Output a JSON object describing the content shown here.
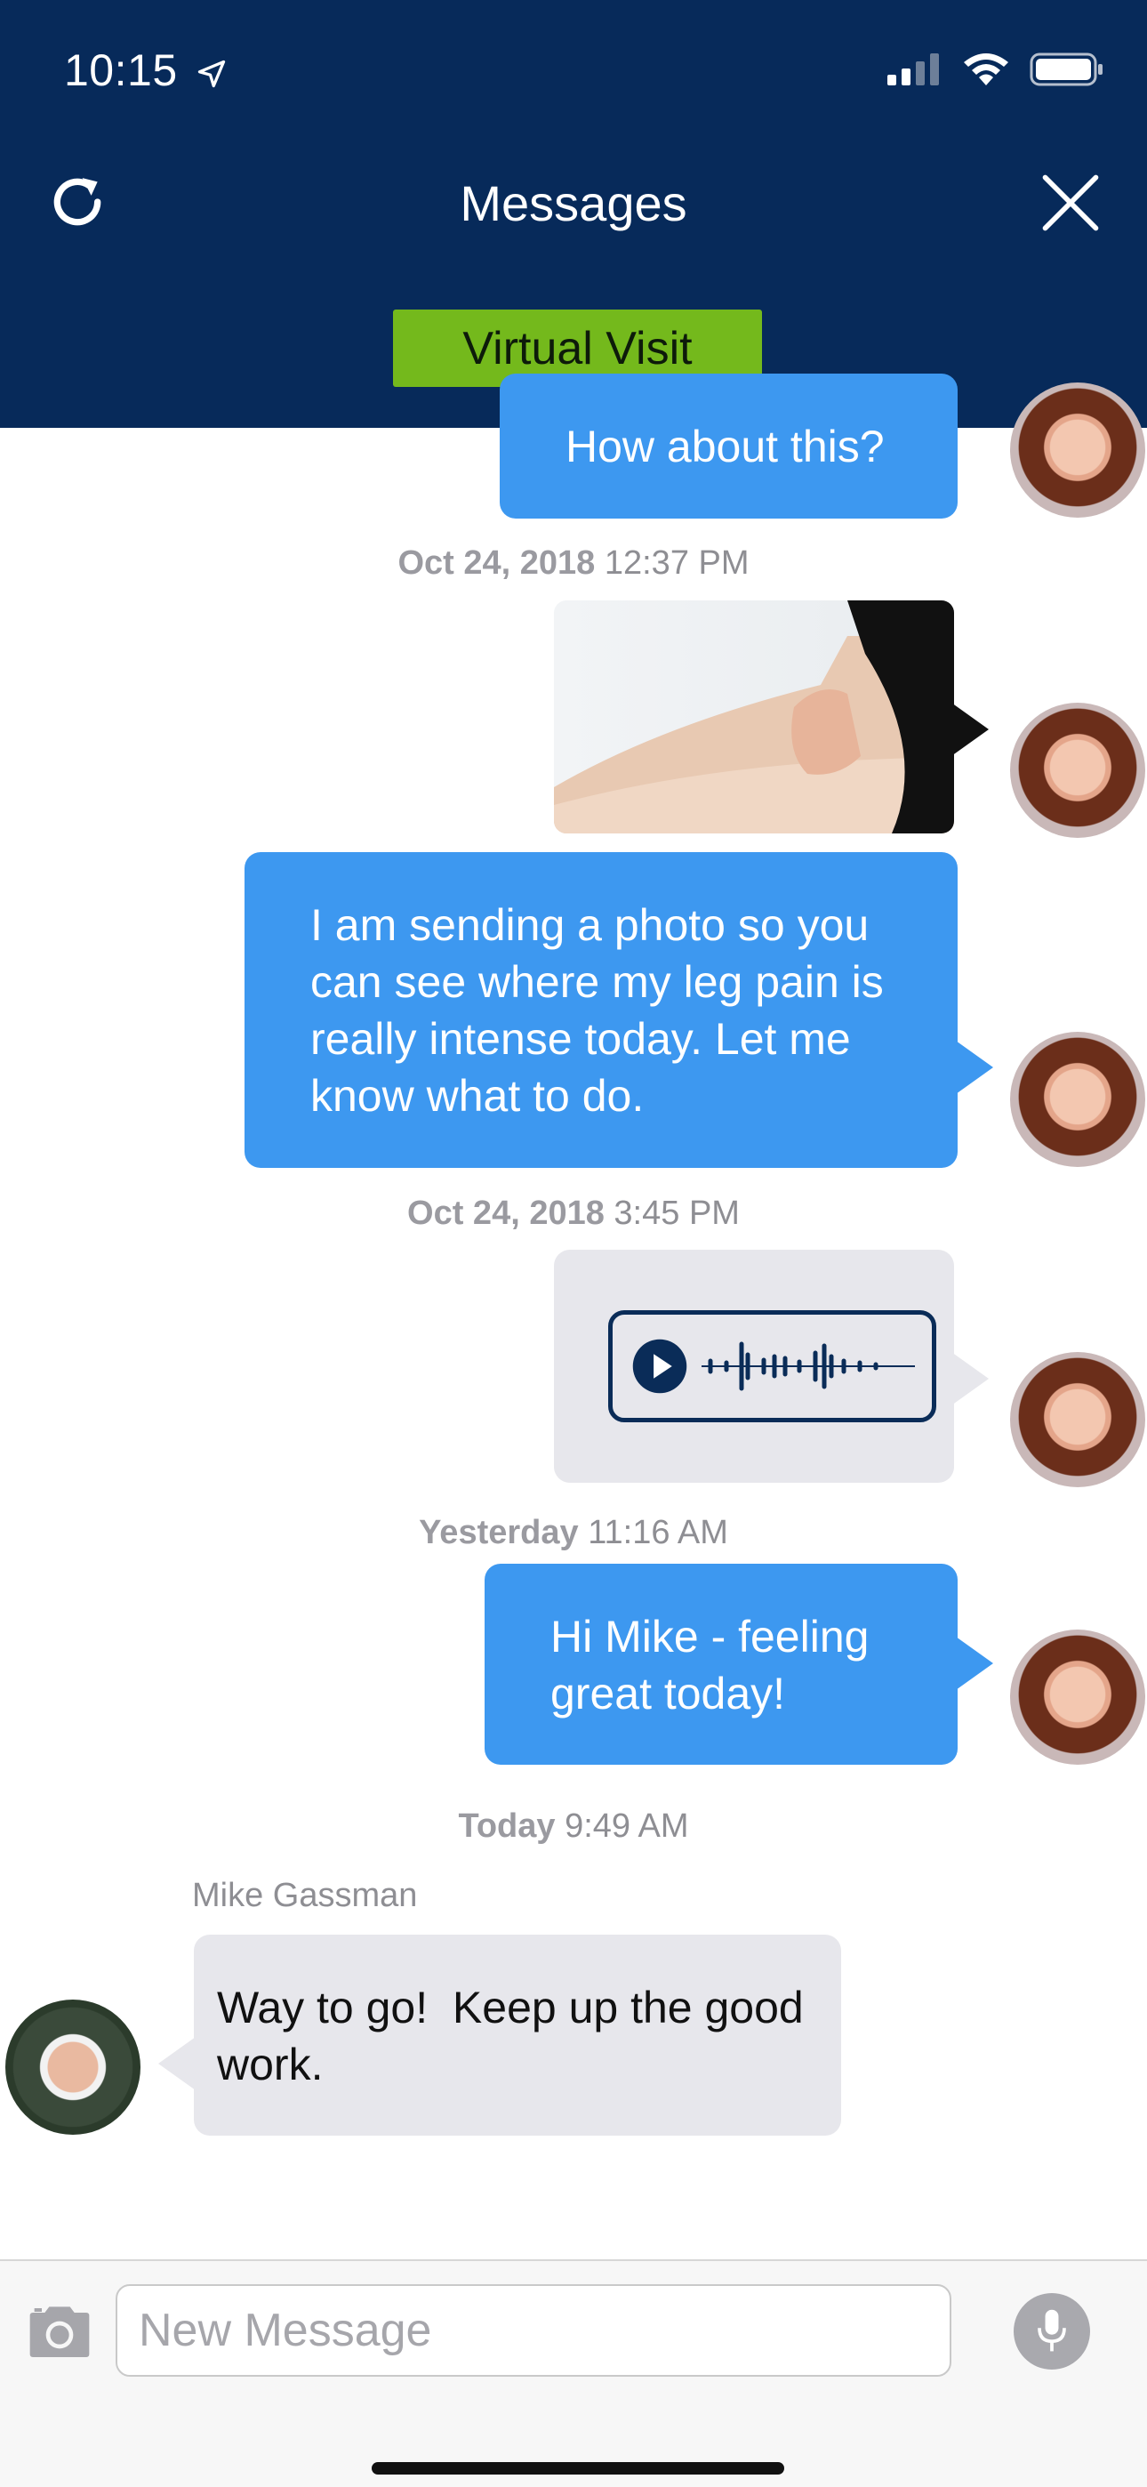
{
  "status_bar": {
    "time": "10:15",
    "location_icon": "location-arrow-icon",
    "signal_icon": "cellular-signal-icon",
    "wifi_icon": "wifi-icon",
    "battery_icon": "battery-icon"
  },
  "header": {
    "title": "Messages",
    "refresh_icon": "refresh-icon",
    "close_icon": "close-icon",
    "virtual_visit_label": "Virtual Visit"
  },
  "colors": {
    "header_bg": "#072a5a",
    "outgoing_bubble": "#3d98f0",
    "incoming_bubble": "#e7e7ec",
    "virtual_visit_bg": "#74b91c"
  },
  "messages": [
    {
      "type": "text",
      "direction": "outgoing",
      "text": "How about this?"
    },
    {
      "type": "timestamp",
      "day": "Oct 24, 2018",
      "time": "12:37 PM"
    },
    {
      "type": "image",
      "direction": "outgoing"
    },
    {
      "type": "text",
      "direction": "outgoing",
      "text": "I am sending a photo so you can see where my leg pain is really intense today. Let me know what to do."
    },
    {
      "type": "timestamp",
      "day": "Oct 24, 2018",
      "time": "3:45 PM"
    },
    {
      "type": "audio",
      "direction": "outgoing",
      "play_icon": "play-icon"
    },
    {
      "type": "timestamp",
      "day": "Yesterday",
      "time": "11:16 AM"
    },
    {
      "type": "text",
      "direction": "outgoing",
      "text": "Hi Mike - feeling great today!"
    },
    {
      "type": "timestamp",
      "day": "Today",
      "time": "9:49 AM"
    },
    {
      "type": "text",
      "direction": "incoming",
      "sender": "Mike Gassman",
      "text": "Way to go!  Keep up the good work."
    }
  ],
  "composer": {
    "placeholder": "New Message",
    "camera_icon": "camera-icon",
    "mic_icon": "microphone-icon"
  }
}
